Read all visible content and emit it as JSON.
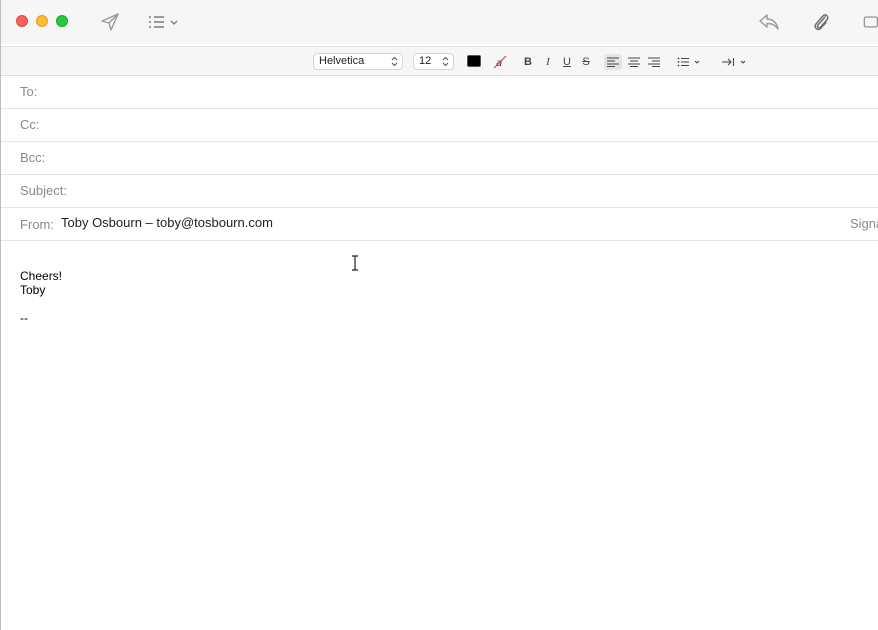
{
  "compose": {
    "fields": {
      "to_label": "To:",
      "cc_label": "Cc:",
      "bcc_label": "Bcc:",
      "subject_label": "Subject:",
      "from_label": "From:",
      "from_value": "Toby Osbourn – toby@tosbourn.com",
      "signature_label": "Signa"
    },
    "format": {
      "font": "Helvetica",
      "size": "12",
      "text_color": "#000000",
      "bold": "B",
      "italic": "I",
      "underline": "U",
      "strike": "S"
    },
    "body": {
      "line1": "Cheers!",
      "line2": "Toby",
      "line3": "--"
    }
  },
  "icons": [
    "send-icon",
    "header-fields-icon",
    "reply-icon",
    "attachment-icon",
    "photo-browser-icon",
    "cursor-ibeam-icon"
  ],
  "colors": {
    "close": "#fe5f57",
    "minimize": "#febc2e",
    "zoom": "#28c840"
  }
}
